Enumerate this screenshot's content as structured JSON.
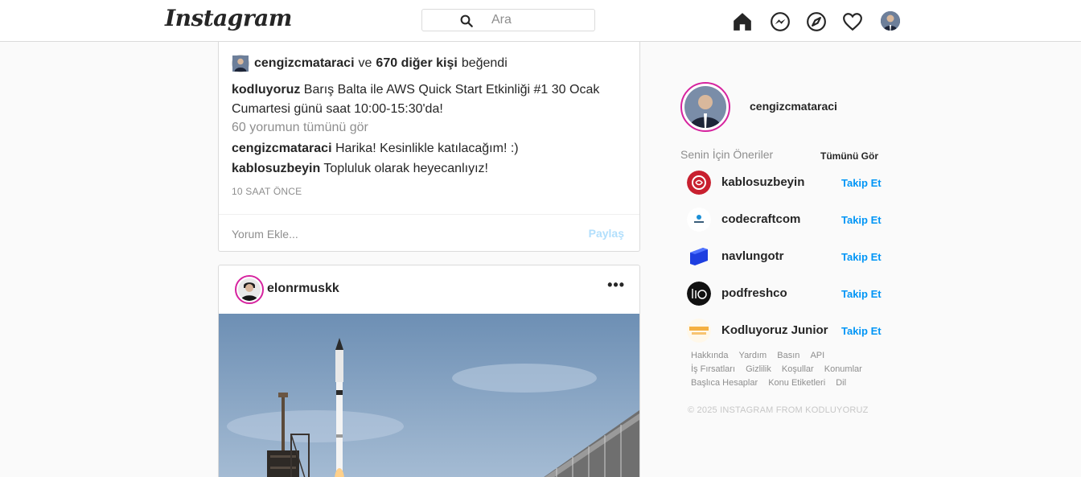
{
  "header": {
    "logo": "Instagram",
    "search_placeholder": "Ara",
    "icons": [
      "home-icon",
      "messenger-icon",
      "explore-icon",
      "heart-icon",
      "profile-avatar"
    ]
  },
  "post1": {
    "liked_by_user": "cengizcmataraci",
    "liked_conj": "ve",
    "liked_others": "670 diğer kişi",
    "liked_suffix": "beğendi",
    "caption_user": "kodluyoruz",
    "caption_text": "Barış Balta ile AWS Quick Start Etkinliği #1 30 Ocak  Cumartesi günü saat 10:00-15:30'da!",
    "view_comments": "60 yorumun tümünü gör",
    "comments": [
      {
        "user": "cengizcmataraci",
        "text": "Harika! Kesinlikle katılacağım! :)"
      },
      {
        "user": "kablosuzbeyin",
        "text": "Topluluk olarak heyecanlıyız!"
      }
    ],
    "time": "10 SAAT ÖNCE",
    "comment_placeholder": "Yorum Ekle...",
    "share_label": "Paylaş"
  },
  "post2": {
    "user": "elonrmuskk",
    "more": "•••"
  },
  "sidebar": {
    "username": "cengizcmataraci",
    "suggestions_title": "Senin İçin Öneriler",
    "see_all": "Tümünü Gör",
    "suggestions": [
      {
        "name": "kablosuzbeyin",
        "follow": "Takip Et",
        "color": "#c8202f"
      },
      {
        "name": "codecraftcom",
        "follow": "Takip Et",
        "color": "#ffffff"
      },
      {
        "name": "navlungotr",
        "follow": "Takip Et",
        "color": "#1e3fe0"
      },
      {
        "name": "podfreshco",
        "follow": "Takip Et",
        "color": "#111111"
      },
      {
        "name": "Kodluyoruz Junior",
        "follow": "Takip Et",
        "color": "#f5b041"
      }
    ],
    "footer_links": [
      "Hakkında",
      "Yardım",
      "Basın",
      "API",
      "İş Fırsatları",
      "Gizlilik",
      "Koşullar",
      "Konumlar",
      "Başlıca Hesaplar",
      "Konu Etiketleri",
      "Dil"
    ],
    "copyright": "© 2025 INSTAGRAM FROM KODLUYORUZ"
  }
}
